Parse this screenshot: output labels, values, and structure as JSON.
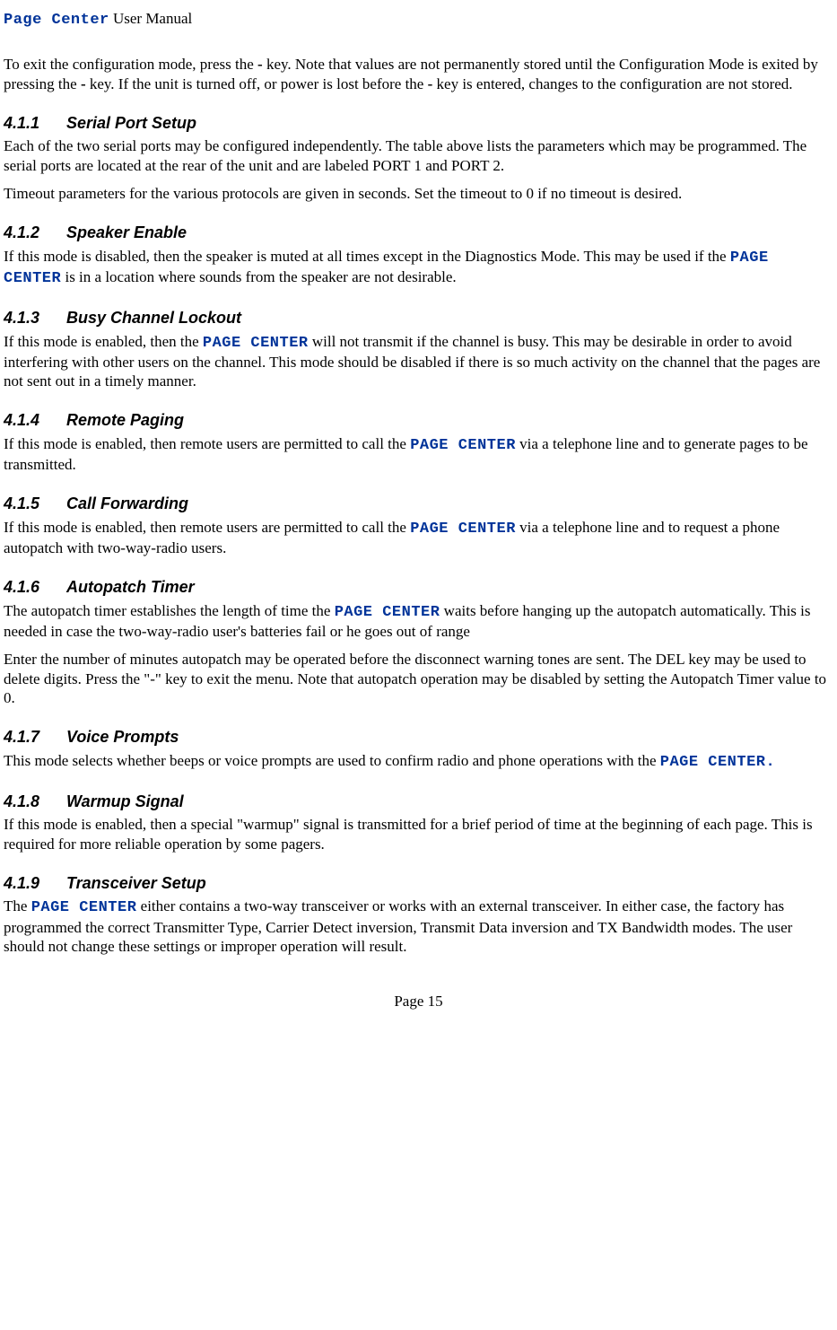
{
  "header": {
    "brand": "Page Center",
    "suffix": " User Manual"
  },
  "intro": {
    "p1a": "To exit the configuration mode, press the ",
    "key1": "-",
    "p1b": " key.  Note that values are not permanently stored until the Configuration Mode is exited by pressing the ",
    "key2": "-",
    "p1c": " key.  If the unit is turned off, or power is lost before the ",
    "key3": "-",
    "p1d": " key is entered, changes to the configuration are not stored."
  },
  "s411": {
    "num": "4.1.1",
    "title": "Serial Port Setup",
    "p1": "Each of the two serial ports may be configured independently.  The table above lists the parameters which may be programmed.  The serial ports are located at the rear of the unit and are labeled PORT 1 and PORT 2.",
    "p2": "Timeout parameters for the various protocols are given in seconds.  Set the timeout to 0 if no timeout is desired."
  },
  "s412": {
    "num": "4.1.2",
    "title": "Speaker Enable",
    "p1a": "If this mode is disabled, then the speaker is muted at all times except in the Diagnostics Mode.  This may be used if the ",
    "pc": "PAGE CENTER",
    "p1b": " is in a location where sounds from the speaker are not desirable."
  },
  "s413": {
    "num": "4.1.3",
    "title": "Busy Channel Lockout",
    "p1a": "If this mode is enabled, then the ",
    "pc": "PAGE CENTER",
    "p1b": " will not transmit if the channel is busy.  This may be desirable in order to avoid interfering with other users on the channel.  This mode should be disabled if there is so much activity on the channel that the pages are not sent out in a timely manner."
  },
  "s414": {
    "num": "4.1.4",
    "title": "Remote Paging",
    "p1a": "If this mode is enabled, then remote users are permitted to call the ",
    "pc": "PAGE CENTER",
    "p1b": " via a telephone line and to generate pages to be transmitted."
  },
  "s415": {
    "num": "4.1.5",
    "title": "Call Forwarding",
    "p1a": "If this mode is enabled, then remote users are permitted to call the ",
    "pc": "PAGE CENTER",
    "p1b": " via a telephone line and to request a phone autopatch with two-way-radio users."
  },
  "s416": {
    "num": "4.1.6",
    "title": "Autopatch Timer",
    "p1a": "The autopatch timer establishes the length of time the ",
    "pc": "PAGE CENTER",
    "p1b": " waits before hanging up the autopatch automatically.  This is needed in case the two-way-radio user's batteries fail or he goes out of range",
    "p2": "Enter the number of minutes autopatch may be operated before the disconnect warning tones are sent. The DEL key may be used to delete digits.  Press the \"-\" key to exit the menu.  Note that autopatch operation may be disabled by setting the Autopatch Timer value to 0."
  },
  "s417": {
    "num": "4.1.7",
    "title": "Voice Prompts",
    "p1a": "This mode selects whether beeps or voice prompts are used to confirm radio and phone operations with the ",
    "pc": "PAGE CENTER."
  },
  "s418": {
    "num": "4.1.8",
    "title": "Warmup Signal",
    "p1": "If this mode is enabled, then a special \"warmup\" signal is transmitted for a brief period of time at the beginning of each page.  This is required for more reliable operation by some pagers."
  },
  "s419": {
    "num": "4.1.9",
    "title": "Transceiver Setup",
    "p1a": "The ",
    "pc": "PAGE CENTER",
    "p1b": " either contains a two-way transceiver or works with an external transceiver.  In either case, the factory has programmed the correct Transmitter Type, Carrier Detect inversion, Transmit Data inversion and TX Bandwidth modes.  The user should not change these settings or improper operation will result."
  },
  "footer": {
    "page": "Page 15"
  }
}
